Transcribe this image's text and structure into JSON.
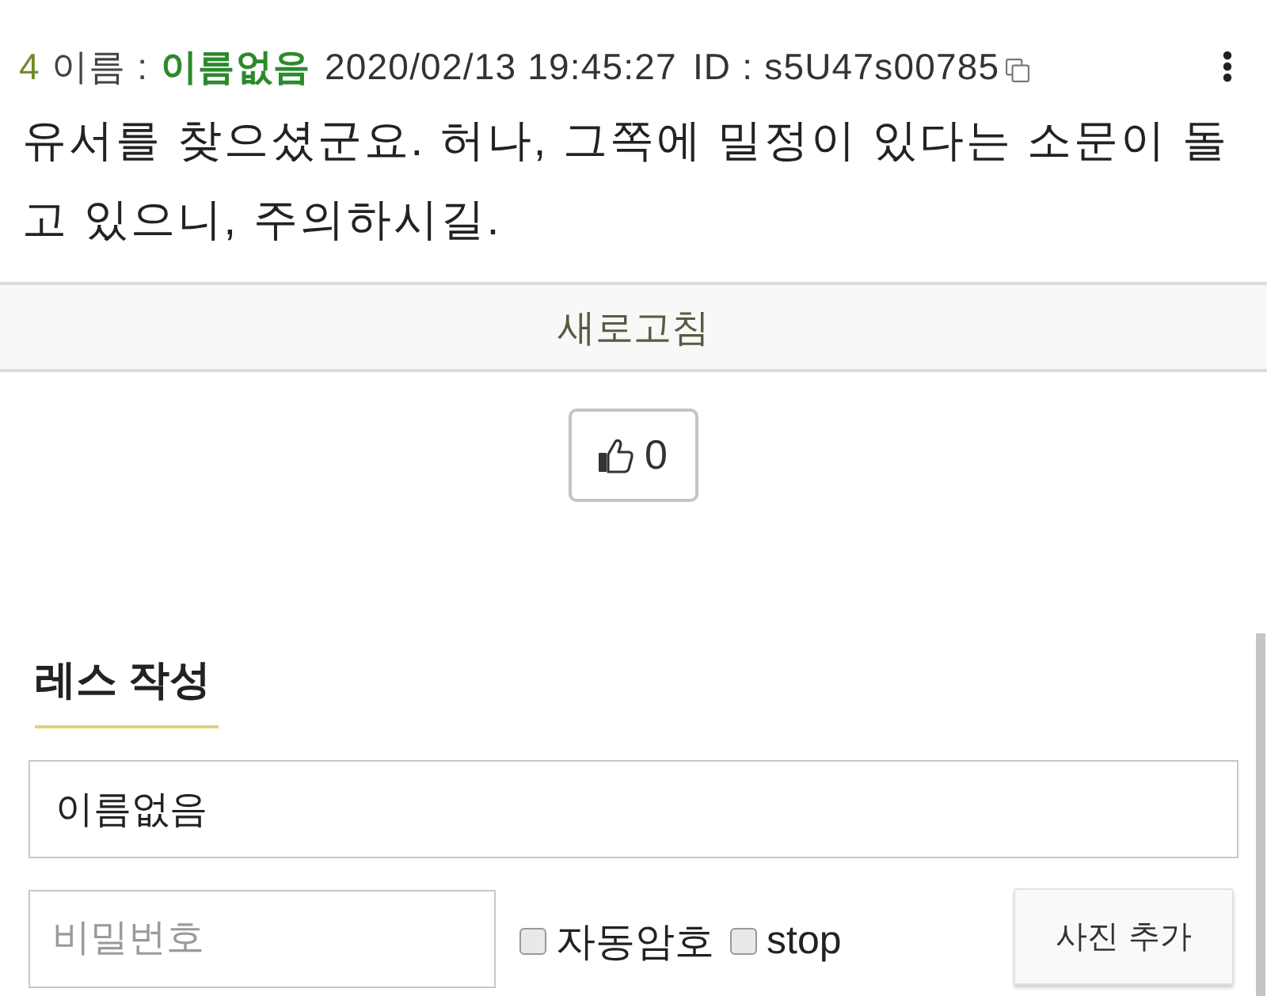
{
  "post": {
    "number": "4",
    "name_label": "이름 :",
    "name": "이름없음",
    "date": "2020/02/13 19:45:27",
    "id_label": "ID : s5U47s00785",
    "body": "유서를 찾으셨군요. 허나, 그쪽에 밀정이 있다는 소문이 돌고 있으니, 주의하시길."
  },
  "refresh": {
    "label": "새로고침"
  },
  "like": {
    "count": "0"
  },
  "reply_form": {
    "title": "레스 작성",
    "name_field": {
      "value": "이름없음"
    },
    "password_field": {
      "placeholder": "비밀번호"
    },
    "options": [
      {
        "label": "자동암호",
        "checked": false
      },
      {
        "label": "stop",
        "checked": false
      }
    ],
    "photo_button": "사진 추가"
  }
}
